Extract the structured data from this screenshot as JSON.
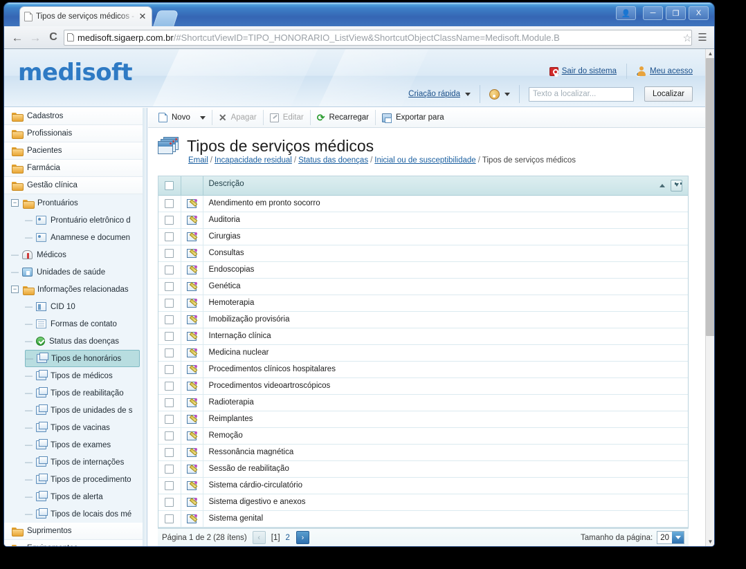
{
  "browser": {
    "tab_title": "Tipos de serviços médicos - M",
    "tab_close": "✕",
    "back_icon": "←",
    "forward_icon": "→",
    "reload_icon": "C",
    "url_strong": "medisoft.sigaerp.com.br",
    "url_dim": "/#ShortcutViewID=TIPO_HONORARIO_ListView&ShortcutObjectClassName=Medisoft.Module.B",
    "star_icon": "☆",
    "menu_icon": "☰",
    "window_buttons": [
      "&",
      "—",
      "❐",
      "X"
    ]
  },
  "header": {
    "brand": "medisoft",
    "logout_label": "Sair do sistema",
    "myaccess_label": "Meu acesso",
    "quick_create_label": "Criação rápida",
    "search_placeholder": "Texto a localizar...",
    "search_value": "",
    "find_button": "Localizar"
  },
  "sidebar": {
    "items": [
      {
        "label": "Cadastros",
        "kind": "group",
        "level": 0,
        "icon": "folder-icon"
      },
      {
        "label": "Profissionais",
        "kind": "group",
        "level": 0,
        "icon": "folder-icon"
      },
      {
        "label": "Pacientes",
        "kind": "group",
        "level": 0,
        "icon": "folder-icon"
      },
      {
        "label": "Farmácia",
        "kind": "group",
        "level": 0,
        "icon": "folder-icon"
      },
      {
        "label": "Gestão clínica",
        "kind": "group",
        "level": 0,
        "icon": "folder-icon"
      },
      {
        "label": "Prontuários",
        "kind": "node",
        "level": 1,
        "icon": "folder-icon",
        "expander": "−"
      },
      {
        "label": "Prontuário eletrônico d",
        "kind": "leaf",
        "level": 2,
        "icon": "card-icon"
      },
      {
        "label": "Anamnese e documen",
        "kind": "leaf",
        "level": 2,
        "icon": "card-icon"
      },
      {
        "label": "Médicos",
        "kind": "leaf",
        "level": 1,
        "icon": "doctor-icon"
      },
      {
        "label": "Unidades de saúde",
        "kind": "leaf",
        "level": 1,
        "icon": "house-icon"
      },
      {
        "label": "Informações relacionadas",
        "kind": "node",
        "level": 1,
        "icon": "folder-icon",
        "expander": "−"
      },
      {
        "label": "CID 10",
        "kind": "leaf",
        "level": 2,
        "icon": "book-icon"
      },
      {
        "label": "Formas de contato",
        "kind": "leaf",
        "level": 2,
        "icon": "lines-icon"
      },
      {
        "label": "Status das doenças",
        "kind": "leaf",
        "level": 2,
        "icon": "check-icon"
      },
      {
        "label": "Tipos de honorários",
        "kind": "leaf",
        "level": 2,
        "icon": "stack-icon",
        "selected": true
      },
      {
        "label": "Tipos de médicos",
        "kind": "leaf",
        "level": 2,
        "icon": "stack-icon"
      },
      {
        "label": "Tipos de reabilitação",
        "kind": "leaf",
        "level": 2,
        "icon": "stack-icon"
      },
      {
        "label": "Tipos de unidades de s",
        "kind": "leaf",
        "level": 2,
        "icon": "stack-icon"
      },
      {
        "label": "Tipos de vacinas",
        "kind": "leaf",
        "level": 2,
        "icon": "stack-icon"
      },
      {
        "label": "Tipos de exames",
        "kind": "leaf",
        "level": 2,
        "icon": "stack-icon"
      },
      {
        "label": "Tipos de internações",
        "kind": "leaf",
        "level": 2,
        "icon": "stack-icon"
      },
      {
        "label": "Tipos de procedimento",
        "kind": "leaf",
        "level": 2,
        "icon": "stack-icon"
      },
      {
        "label": "Tipos de alerta",
        "kind": "leaf",
        "level": 2,
        "icon": "stack-icon"
      },
      {
        "label": "Tipos de locais dos mé",
        "kind": "leaf",
        "level": 2,
        "icon": "stack-icon"
      },
      {
        "label": "Suprimentos",
        "kind": "group",
        "level": 0,
        "icon": "folder-icon"
      },
      {
        "label": "Equipamentos",
        "kind": "group",
        "level": 0,
        "icon": "folder-icon"
      }
    ]
  },
  "toolbar": {
    "new_label": "Novo",
    "delete_label": "Apagar",
    "edit_label": "Editar",
    "reload_label": "Recarregar",
    "export_label": "Exportar para"
  },
  "page": {
    "title": "Tipos de serviços médicos",
    "breadcrumb": [
      {
        "label": "Email",
        "link": true
      },
      {
        "label": "Incapacidade residual",
        "link": true
      },
      {
        "label": "Status das doenças",
        "link": true
      },
      {
        "label": "Inicial ou de susceptibilidade",
        "link": true
      },
      {
        "label": "Tipos de serviços médicos",
        "link": false
      }
    ],
    "breadcrumb_separator": "/"
  },
  "grid": {
    "column_header": "Descrição",
    "sort_direction": "asc",
    "rows": [
      "Atendimento em pronto socorro",
      "Auditoria",
      "Cirurgias",
      "Consultas",
      "Endoscopias",
      "Genética",
      "Hemoterapia",
      "Imobilização provisória",
      "Internação clínica",
      "Medicina nuclear",
      "Procedimentos clínicos hospitalares",
      "Procedimentos videoartroscópicos",
      "Radioterapia",
      "Reimplantes",
      "Remoção",
      "Ressonância magnética",
      "Sessão de reabilitação",
      "Sistema cárdio-circulatório",
      "Sistema digestivo e anexos",
      "Sistema genital"
    ]
  },
  "pager": {
    "status": "Página 1 de 2 (28 ítens)",
    "prev_icon": "‹",
    "next_icon": "›",
    "pages": [
      "[1]",
      "2"
    ],
    "page_size_label": "Tamanho da página:",
    "page_size_value": "20"
  },
  "colors": {
    "brand_blue": "#2e7ac4",
    "link_blue": "#1a5fa0",
    "grid_header": "#c9e3e7",
    "selection": "#b8dde0"
  }
}
